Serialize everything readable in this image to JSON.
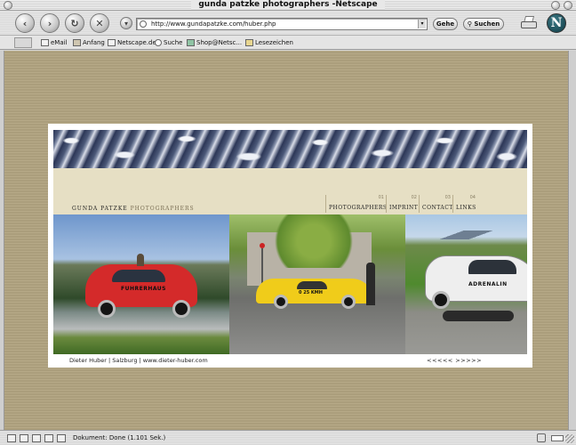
{
  "window": {
    "title": "gunda patzke photographers -Netscape"
  },
  "navbar": {
    "back_icon": "back-arrow-icon",
    "forward_icon": "forward-arrow-icon",
    "reload_icon": "reload-icon",
    "stop_icon": "stop-icon",
    "url": "http://www.gundapatzke.com/huber.php",
    "go_label": "Gehe",
    "search_label": "Suchen"
  },
  "personal_toolbar": {
    "items": [
      {
        "label": "eMail",
        "icon": "mail-icon"
      },
      {
        "label": "Anfang",
        "icon": "home-icon"
      },
      {
        "label": "Netscape.de",
        "icon": "netscape-icon"
      },
      {
        "label": "Suche",
        "icon": "search-icon"
      },
      {
        "label": "Shop@Netsc...",
        "icon": "shop-icon"
      },
      {
        "label": "Lesezeichen",
        "icon": "bookmarks-icon"
      }
    ]
  },
  "site": {
    "brand_dark": "GUNDA PATZKE",
    "brand_light": "PHOTOGRAPHERS",
    "menu": [
      {
        "num": "01",
        "label": "PHOTOGRAPHERS"
      },
      {
        "num": "02",
        "label": "IMPRINT"
      },
      {
        "num": "03",
        "label": "CONTACT"
      },
      {
        "num": "04",
        "label": "LINKS"
      }
    ],
    "photo1_text": "FUHRERHAUS",
    "photo2_text": "0 25 KMH",
    "photo3_text": "ADRENALIN",
    "caption": "Dieter Huber | Salzburg | www.dieter-huber.com",
    "pager": "<<<<<  >>>>>"
  },
  "status": {
    "text": "Dokument: Done (1.101 Sek.)"
  }
}
